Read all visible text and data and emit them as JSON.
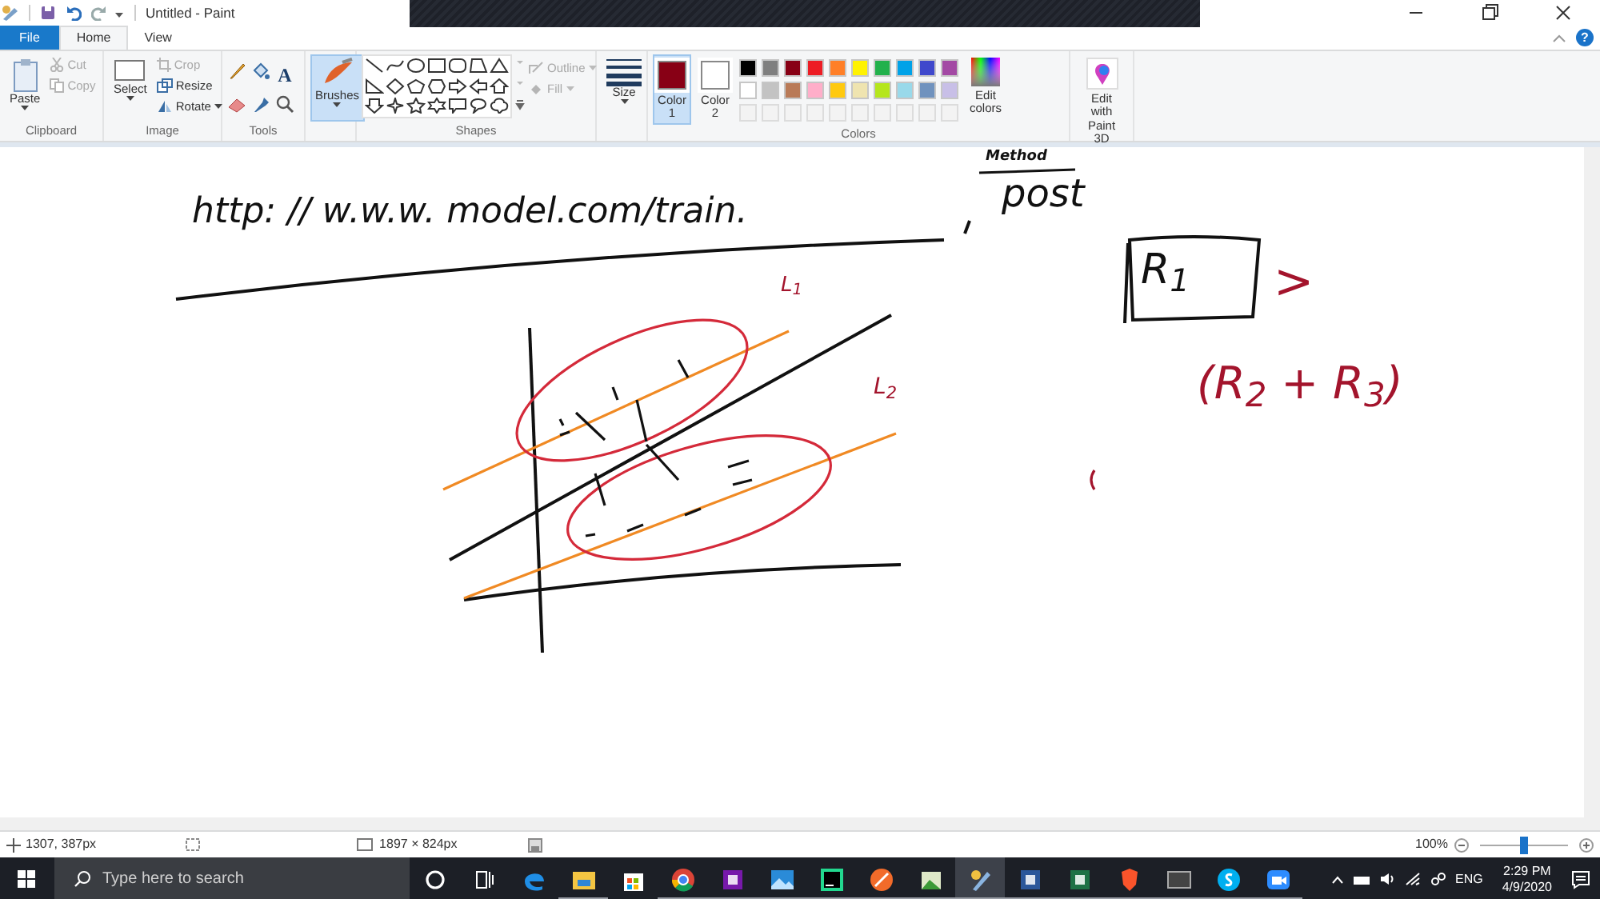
{
  "window": {
    "title": "Untitled - Paint",
    "help": "?"
  },
  "tabs": [
    {
      "label": "File",
      "kind": "file",
      "selected": false
    },
    {
      "label": "Home",
      "kind": "tab",
      "selected": true
    },
    {
      "label": "View",
      "kind": "tab",
      "selected": false
    }
  ],
  "clipboard": {
    "title": "Clipboard",
    "paste": "Paste",
    "cut": {
      "label": "Cut",
      "disabled": true
    },
    "copy": {
      "label": "Copy",
      "disabled": true
    }
  },
  "image": {
    "title": "Image",
    "select": "Select",
    "crop": {
      "label": "Crop",
      "disabled": true
    },
    "resize": {
      "label": "Resize",
      "disabled": false
    },
    "rotate": {
      "label": "Rotate",
      "disabled": false
    }
  },
  "tools": {
    "title": "Tools",
    "text_tool": "A"
  },
  "brushes": {
    "label": "Brushes",
    "selected": true
  },
  "shapes": {
    "title": "Shapes",
    "outline": {
      "label": "Outline",
      "disabled": true
    },
    "fill": {
      "label": "Fill",
      "disabled": true
    }
  },
  "size": {
    "label": "Size"
  },
  "colors": {
    "title": "Colors",
    "color1": {
      "label": "Color",
      "number": "1",
      "color": "#880015",
      "selected": true
    },
    "color2": {
      "label": "Color",
      "number": "2",
      "color": "#ffffff",
      "selected": false
    },
    "palette": [
      {
        "color": "#000000"
      },
      {
        "color": "#7f7f7f"
      },
      {
        "color": "#880015"
      },
      {
        "color": "#ed1c24"
      },
      {
        "color": "#ff7f27"
      },
      {
        "color": "#fff200"
      },
      {
        "color": "#22b14c"
      },
      {
        "color": "#00a2e8"
      },
      {
        "color": "#3f48cc"
      },
      {
        "color": "#a349a4"
      },
      {
        "color": "#ffffff"
      },
      {
        "color": "#c3c3c3"
      },
      {
        "color": "#b97a57"
      },
      {
        "color": "#ffaec9"
      },
      {
        "color": "#ffc90e"
      },
      {
        "color": "#efe4b0"
      },
      {
        "color": "#b5e61d"
      },
      {
        "color": "#99d9ea"
      },
      {
        "color": "#7092be"
      },
      {
        "color": "#c8bfe7"
      }
    ],
    "edit_colors": "Edit colors",
    "paint3d": "Edit with Paint 3D"
  },
  "canvas": {
    "texts": [
      {
        "kind": "url",
        "text": "http: // w.w.w.  model.com/train.",
        "color": "#111111"
      },
      {
        "kind": "method",
        "text": "Method",
        "color": "#111111"
      },
      {
        "kind": "post",
        "text": "post",
        "color": "#111111"
      },
      {
        "kind": "l1",
        "text": "L$_{1}$",
        "color": "#a3142c"
      },
      {
        "kind": "l2",
        "text": "L$_{2}$",
        "color": "#a3142c"
      },
      {
        "kind": "r1",
        "text": "R$_{1}$",
        "color": "#111111"
      },
      {
        "kind": "gt",
        "text": ">",
        "color": "#a3142c"
      },
      {
        "kind": "sum",
        "text": "(R$_{2}$ + R$_{3}$)",
        "color": "#a3142c"
      }
    ]
  },
  "status_bar": {
    "cursor": "1307, 387px",
    "canvas_size": "1897 × 824px",
    "zoom": "100%",
    "zoom_slider": {
      "level": 0.5
    }
  },
  "taskbar": {
    "search": {
      "placeholder": "Type here to search"
    },
    "apps": [
      {
        "kind": "cortana",
        "running": false,
        "active": false
      },
      {
        "kind": "taskview",
        "running": false,
        "active": false
      },
      {
        "kind": "edge",
        "running": false,
        "active": false
      },
      {
        "kind": "explorer",
        "running": true,
        "active": false
      },
      {
        "kind": "store",
        "running": false,
        "active": false
      },
      {
        "kind": "chrome",
        "running": true,
        "active": false
      },
      {
        "kind": "onenote",
        "running": true,
        "active": false
      },
      {
        "kind": "photos",
        "running": true,
        "active": false
      },
      {
        "kind": "pycharm",
        "running": true,
        "active": false
      },
      {
        "kind": "sketch",
        "running": true,
        "active": false
      },
      {
        "kind": "gallery",
        "running": true,
        "active": false
      },
      {
        "kind": "paint",
        "running": true,
        "active": true
      },
      {
        "kind": "word",
        "running": true,
        "active": false
      },
      {
        "kind": "excel",
        "running": true,
        "active": false
      },
      {
        "kind": "brave",
        "running": true,
        "active": false
      },
      {
        "kind": "terminal",
        "running": true,
        "active": false
      },
      {
        "kind": "skype",
        "running": true,
        "active": false
      },
      {
        "kind": "zoom",
        "running": true,
        "active": false
      }
    ],
    "language": "ENG",
    "time": "2:29 PM",
    "date": "4/9/2020"
  }
}
